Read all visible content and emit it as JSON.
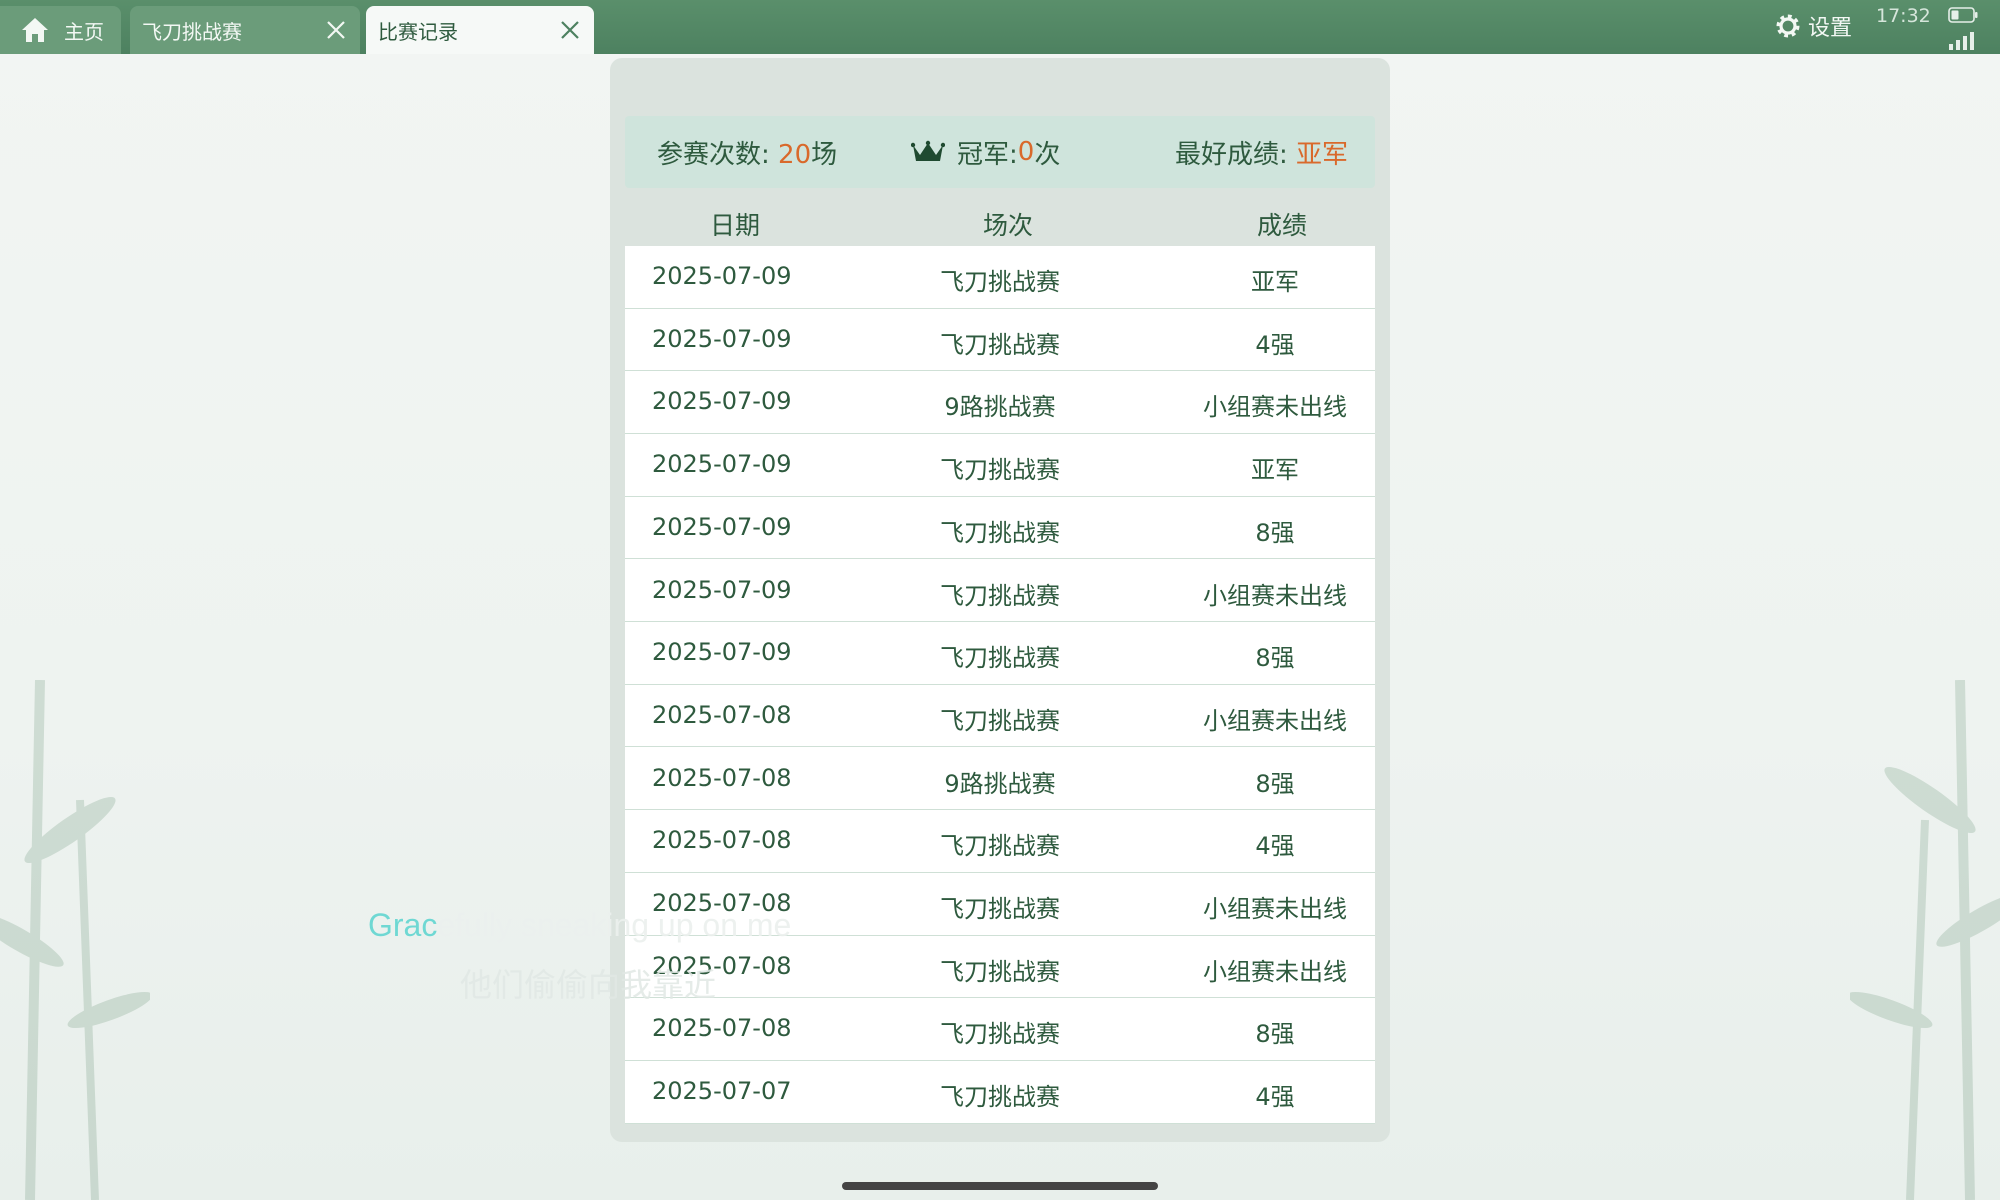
{
  "tabs": [
    {
      "label": "主页",
      "icon": "home-icon"
    },
    {
      "label": "飞刀挑战赛",
      "icon": "close-icon"
    },
    {
      "label": "比赛记录",
      "icon": "close-icon",
      "active": true
    }
  ],
  "status": {
    "settings_label": "设置",
    "time": "17:32"
  },
  "summary": {
    "entries_label": "参赛次数: ",
    "entries_value": "20",
    "entries_unit": "场",
    "champion_label": "冠军: ",
    "champion_value": "0",
    "champion_unit": "次",
    "best_label": "最好成绩: ",
    "best_value": "亚军"
  },
  "table": {
    "headers": [
      "日期",
      "场次",
      "成绩"
    ],
    "rows": [
      [
        "2025-07-09",
        "飞刀挑战赛",
        "亚军"
      ],
      [
        "2025-07-09",
        "飞刀挑战赛",
        "4强"
      ],
      [
        "2025-07-09",
        "9路挑战赛",
        "小组赛未出线"
      ],
      [
        "2025-07-09",
        "飞刀挑战赛",
        "亚军"
      ],
      [
        "2025-07-09",
        "飞刀挑战赛",
        "8强"
      ],
      [
        "2025-07-09",
        "飞刀挑战赛",
        "小组赛未出线"
      ],
      [
        "2025-07-09",
        "飞刀挑战赛",
        "8强"
      ],
      [
        "2025-07-08",
        "飞刀挑战赛",
        "小组赛未出线"
      ],
      [
        "2025-07-08",
        "9路挑战赛",
        "8强"
      ],
      [
        "2025-07-08",
        "飞刀挑战赛",
        "4强"
      ],
      [
        "2025-07-08",
        "飞刀挑战赛",
        "小组赛未出线"
      ],
      [
        "2025-07-08",
        "飞刀挑战赛",
        "小组赛未出线"
      ],
      [
        "2025-07-08",
        "飞刀挑战赛",
        "8强"
      ],
      [
        "2025-07-07",
        "飞刀挑战赛",
        "4强"
      ]
    ]
  },
  "lyrics": {
    "line1_highlight": "Grac",
    "line1_rest": "efully sneaking up on me",
    "line2": "他们偷偷向我靠近"
  },
  "colors": {
    "topbar": "#4d8160",
    "accent_orange": "#d9692b",
    "text_green": "#2e5a3e"
  }
}
